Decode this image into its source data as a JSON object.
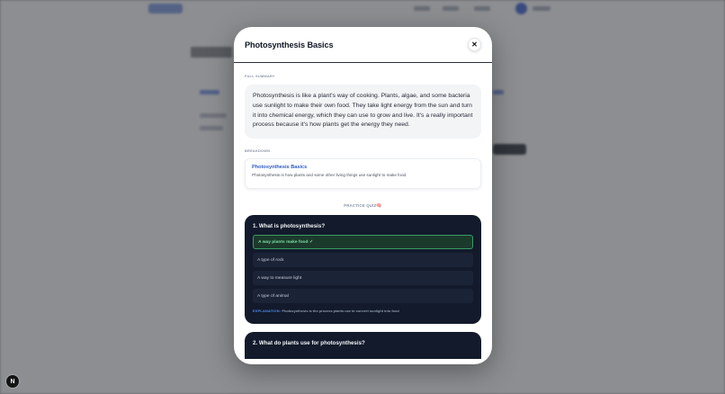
{
  "modal": {
    "title": "Photosynthesis Basics",
    "close_label": "✕"
  },
  "summary": {
    "label": "FULL SUMMARY",
    "text": "Photosynthesis is like a plant's way of cooking. Plants, algae, and some bacteria use sunlight to make their own food. They take light energy from the sun and turn it into chemical energy, which they can use to grow and live. It's a really important process because it's how plants get the energy they need."
  },
  "breakdown": {
    "label": "BREAKDOWN",
    "items": [
      {
        "title": "Photosynthesis Basics",
        "text": "Photosynthesis is how plants and some other living things use sunlight to make food."
      }
    ]
  },
  "quiz": {
    "label": "PRACTICE QUIZ",
    "icon": "brain-icon",
    "questions": [
      {
        "title": "1. What is photosynthesis?",
        "options": [
          "A way plants make food ✓",
          "A type of rock",
          "A way to measure light",
          "A type of animal"
        ],
        "correct_index": 0,
        "explanation_label": "EXPLANATION:",
        "explanation": "Photosynthesis is the process plants use to convert sunlight into food"
      },
      {
        "title": "2. What do plants use for photosynthesis?"
      }
    ]
  },
  "badge": {
    "letter": "N"
  },
  "colors": {
    "accent_blue": "#2d5bc6",
    "quiz_bg": "#121a2b",
    "correct_green": "#3c9a64"
  }
}
